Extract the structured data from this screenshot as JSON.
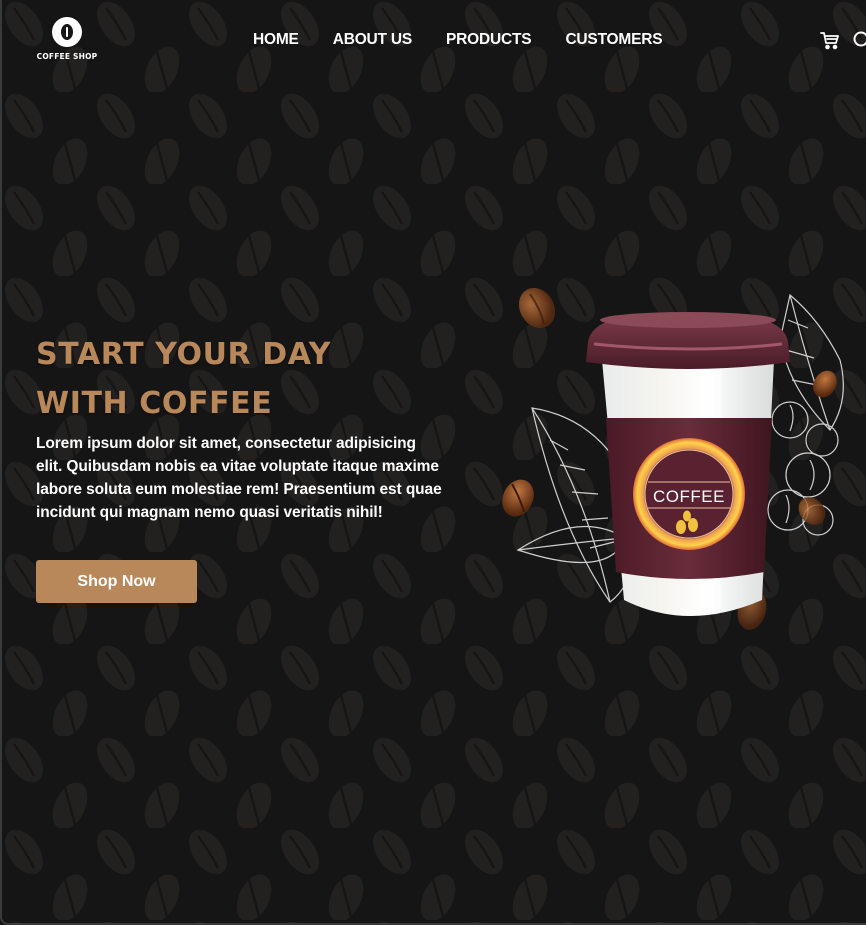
{
  "logo": {
    "text": "COFFEE SHOP"
  },
  "nav": {
    "items": [
      {
        "label": "HOME"
      },
      {
        "label": "ABOUT US"
      },
      {
        "label": "PRODUCTS"
      },
      {
        "label": "CUSTOMERS"
      }
    ]
  },
  "header_icons": [
    "cart-icon",
    "search-icon"
  ],
  "hero": {
    "title_line1": "START YOUR DAY",
    "title_line2": "WITH COFFEE",
    "description": "Lorem ipsum dolor sit amet, consectetur adipisicing elit. Quibusdam nobis ea vitae voluptate itaque maxime labore soluta eum molestiae rem! Praesentium est quae incidunt qui magnam nemo quasi veritatis nihil!",
    "button_label": "Shop Now",
    "cup_label": "COFFEE"
  },
  "colors": {
    "background": "#161515",
    "accent": "#b8885a",
    "cup_sleeve": "#5a2230",
    "text": "#ffffff"
  }
}
